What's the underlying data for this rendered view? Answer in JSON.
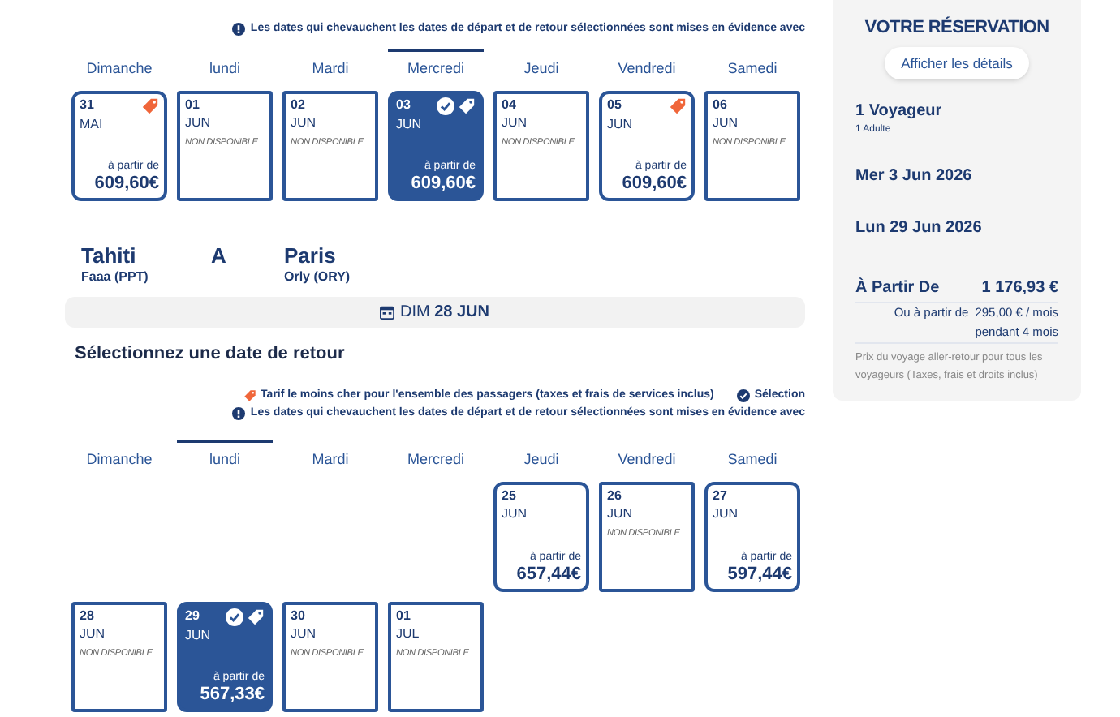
{
  "outbound": {
    "notice": "Les dates qui chevauchent les dates de départ et de retour sélectionnées sont mises en évidence avec",
    "weekdays": [
      {
        "label": "Dimanche",
        "selected": false
      },
      {
        "label": "lundi",
        "selected": false
      },
      {
        "label": "Mardi",
        "selected": false
      },
      {
        "label": "Mercredi",
        "selected": true
      },
      {
        "label": "Jeudi",
        "selected": false
      },
      {
        "label": "Vendredi",
        "selected": false
      },
      {
        "label": "Samedi",
        "selected": false
      }
    ],
    "weeks": [
      [
        {
          "kind": "price",
          "day": "31",
          "month": "MAI",
          "from": "à partir de",
          "price": "609,60€",
          "selected": false,
          "cheapest": true
        },
        {
          "kind": "unavailable",
          "day": "01",
          "month": "JUN",
          "status": "NON DISPONIBLE",
          "selected": false,
          "cheapest": false
        },
        {
          "kind": "unavailable",
          "day": "02",
          "month": "JUN",
          "status": "NON DISPONIBLE",
          "selected": false,
          "cheapest": false
        },
        {
          "kind": "price",
          "day": "03",
          "month": "JUN",
          "from": "à partir de",
          "price": "609,60€",
          "selected": true,
          "cheapest": true
        },
        {
          "kind": "unavailable",
          "day": "04",
          "month": "JUN",
          "status": "NON DISPONIBLE",
          "selected": false,
          "cheapest": false
        },
        {
          "kind": "price",
          "day": "05",
          "month": "JUN",
          "from": "à partir de",
          "price": "609,60€",
          "selected": false,
          "cheapest": true
        },
        {
          "kind": "unavailable",
          "day": "06",
          "month": "JUN",
          "status": "NON DISPONIBLE",
          "selected": false,
          "cheapest": false
        }
      ]
    ]
  },
  "route": {
    "origin": "Tahiti",
    "origin_airport": "Faaa (PPT)",
    "separator": "A",
    "destination": "Paris",
    "destination_airport": "Orly (ORY)"
  },
  "date_bar": "DIM **28 JUN**",
  "return": {
    "heading": "Sélectionnez une date de retour",
    "legend_cheapest": "Tarif le moins cher pour l'ensemble des passagers (taxes et frais de services inclus)",
    "legend_selection": "Sélection",
    "notice": "Les dates qui chevauchent les dates de départ et de retour sélectionnées sont mises en évidence avec",
    "weekdays": [
      {
        "label": "Dimanche",
        "selected": false
      },
      {
        "label": "lundi",
        "selected": true
      },
      {
        "label": "Mardi",
        "selected": false
      },
      {
        "label": "Mercredi",
        "selected": false
      },
      {
        "label": "Jeudi",
        "selected": false
      },
      {
        "label": "Vendredi",
        "selected": false
      },
      {
        "label": "Samedi",
        "selected": false
      }
    ],
    "weeks": [
      [
        {
          "kind": "empty"
        },
        {
          "kind": "empty"
        },
        {
          "kind": "empty"
        },
        {
          "kind": "empty"
        },
        {
          "kind": "price",
          "day": "25",
          "month": "JUN",
          "from": "à partir de",
          "price": "657,44€",
          "selected": false,
          "cheapest": false
        },
        {
          "kind": "unavailable",
          "day": "26",
          "month": "JUN",
          "status": "NON DISPONIBLE",
          "selected": false,
          "cheapest": false
        },
        {
          "kind": "price",
          "day": "27",
          "month": "JUN",
          "from": "à partir de",
          "price": "597,44€",
          "selected": false,
          "cheapest": false
        }
      ],
      [
        {
          "kind": "unavailable",
          "day": "28",
          "month": "JUN",
          "status": "NON DISPONIBLE",
          "selected": false,
          "cheapest": false
        },
        {
          "kind": "price",
          "day": "29",
          "month": "JUN",
          "from": "à partir de",
          "price": "567,33€",
          "selected": true,
          "cheapest": true
        },
        {
          "kind": "unavailable",
          "day": "30",
          "month": "JUN",
          "status": "NON DISPONIBLE",
          "selected": false,
          "cheapest": false
        },
        {
          "kind": "unavailable",
          "day": "01",
          "month": "JUL",
          "status": "NON DISPONIBLE",
          "selected": false,
          "cheapest": false
        }
      ]
    ]
  },
  "reservation": {
    "title": "VOTRE RÉSERVATION",
    "details_button": "Afficher les détails",
    "travellers": "1 Voyageur",
    "travellers_detail": "1 Adulte",
    "outbound_date": "Mer 3 Jun 2026",
    "return_date": "Lun 29 Jun 2026",
    "price_label": "À Partir De",
    "price": "1 176,93 €",
    "monthly_label": "Ou à partir de",
    "monthly_price": "295,00 € / mois",
    "monthly_duration": "pendant 4 mois",
    "note": "Prix du voyage aller-retour pour tous les voyageurs (Taxes, frais et droits inclus)"
  }
}
